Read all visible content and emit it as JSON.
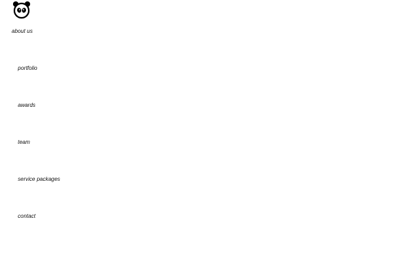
{
  "brand": {
    "logo_icon": "panda-icon",
    "logo_color": "#000000"
  },
  "nav": {
    "items": [
      {
        "label": "about us"
      },
      {
        "label": "portfolio"
      },
      {
        "label": "awards"
      },
      {
        "label": "team"
      },
      {
        "label": "service packages"
      },
      {
        "label": "contact"
      }
    ]
  }
}
